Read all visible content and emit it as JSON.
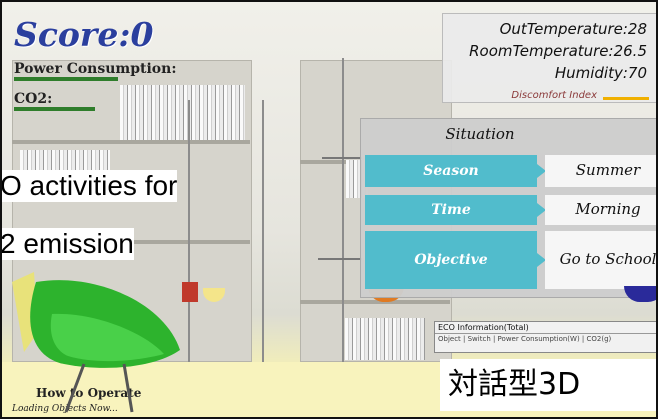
{
  "hud": {
    "score": "Score:0",
    "power_label": "Power Consumption:",
    "power_level": 0.45,
    "co2_label": "CO2:",
    "co2_level": 0.35
  },
  "environment": {
    "out_temperature": "OutTemperature:28",
    "room_temperature": "RoomTemperature:26.5",
    "humidity": "Humidity:70",
    "discomfort_label": "Discomfort Index",
    "discomfort_level": 0.8
  },
  "situation": {
    "title": "Situation",
    "rows": [
      {
        "key": "Season",
        "value": "Summer"
      },
      {
        "key": "Time",
        "value": "Morning"
      },
      {
        "key": "Objective",
        "value": "Go to School"
      }
    ]
  },
  "callouts": {
    "left_line1": "O activities for",
    "left_line2": "2 emission",
    "bottom_right": "対話型3D"
  },
  "eco_panel": {
    "title": "ECO Information(Total)",
    "row": "Object | Switch | Power Consumption(W) | CO2(g)"
  },
  "footer": {
    "how_to_operate": "How to Operate",
    "loading": "Loading Objects Now..."
  },
  "colors": {
    "score": "#2b3f9e",
    "meter": "#2f7d2b",
    "discomfort": "#f0b000",
    "situation_accent": "#51bccc"
  }
}
